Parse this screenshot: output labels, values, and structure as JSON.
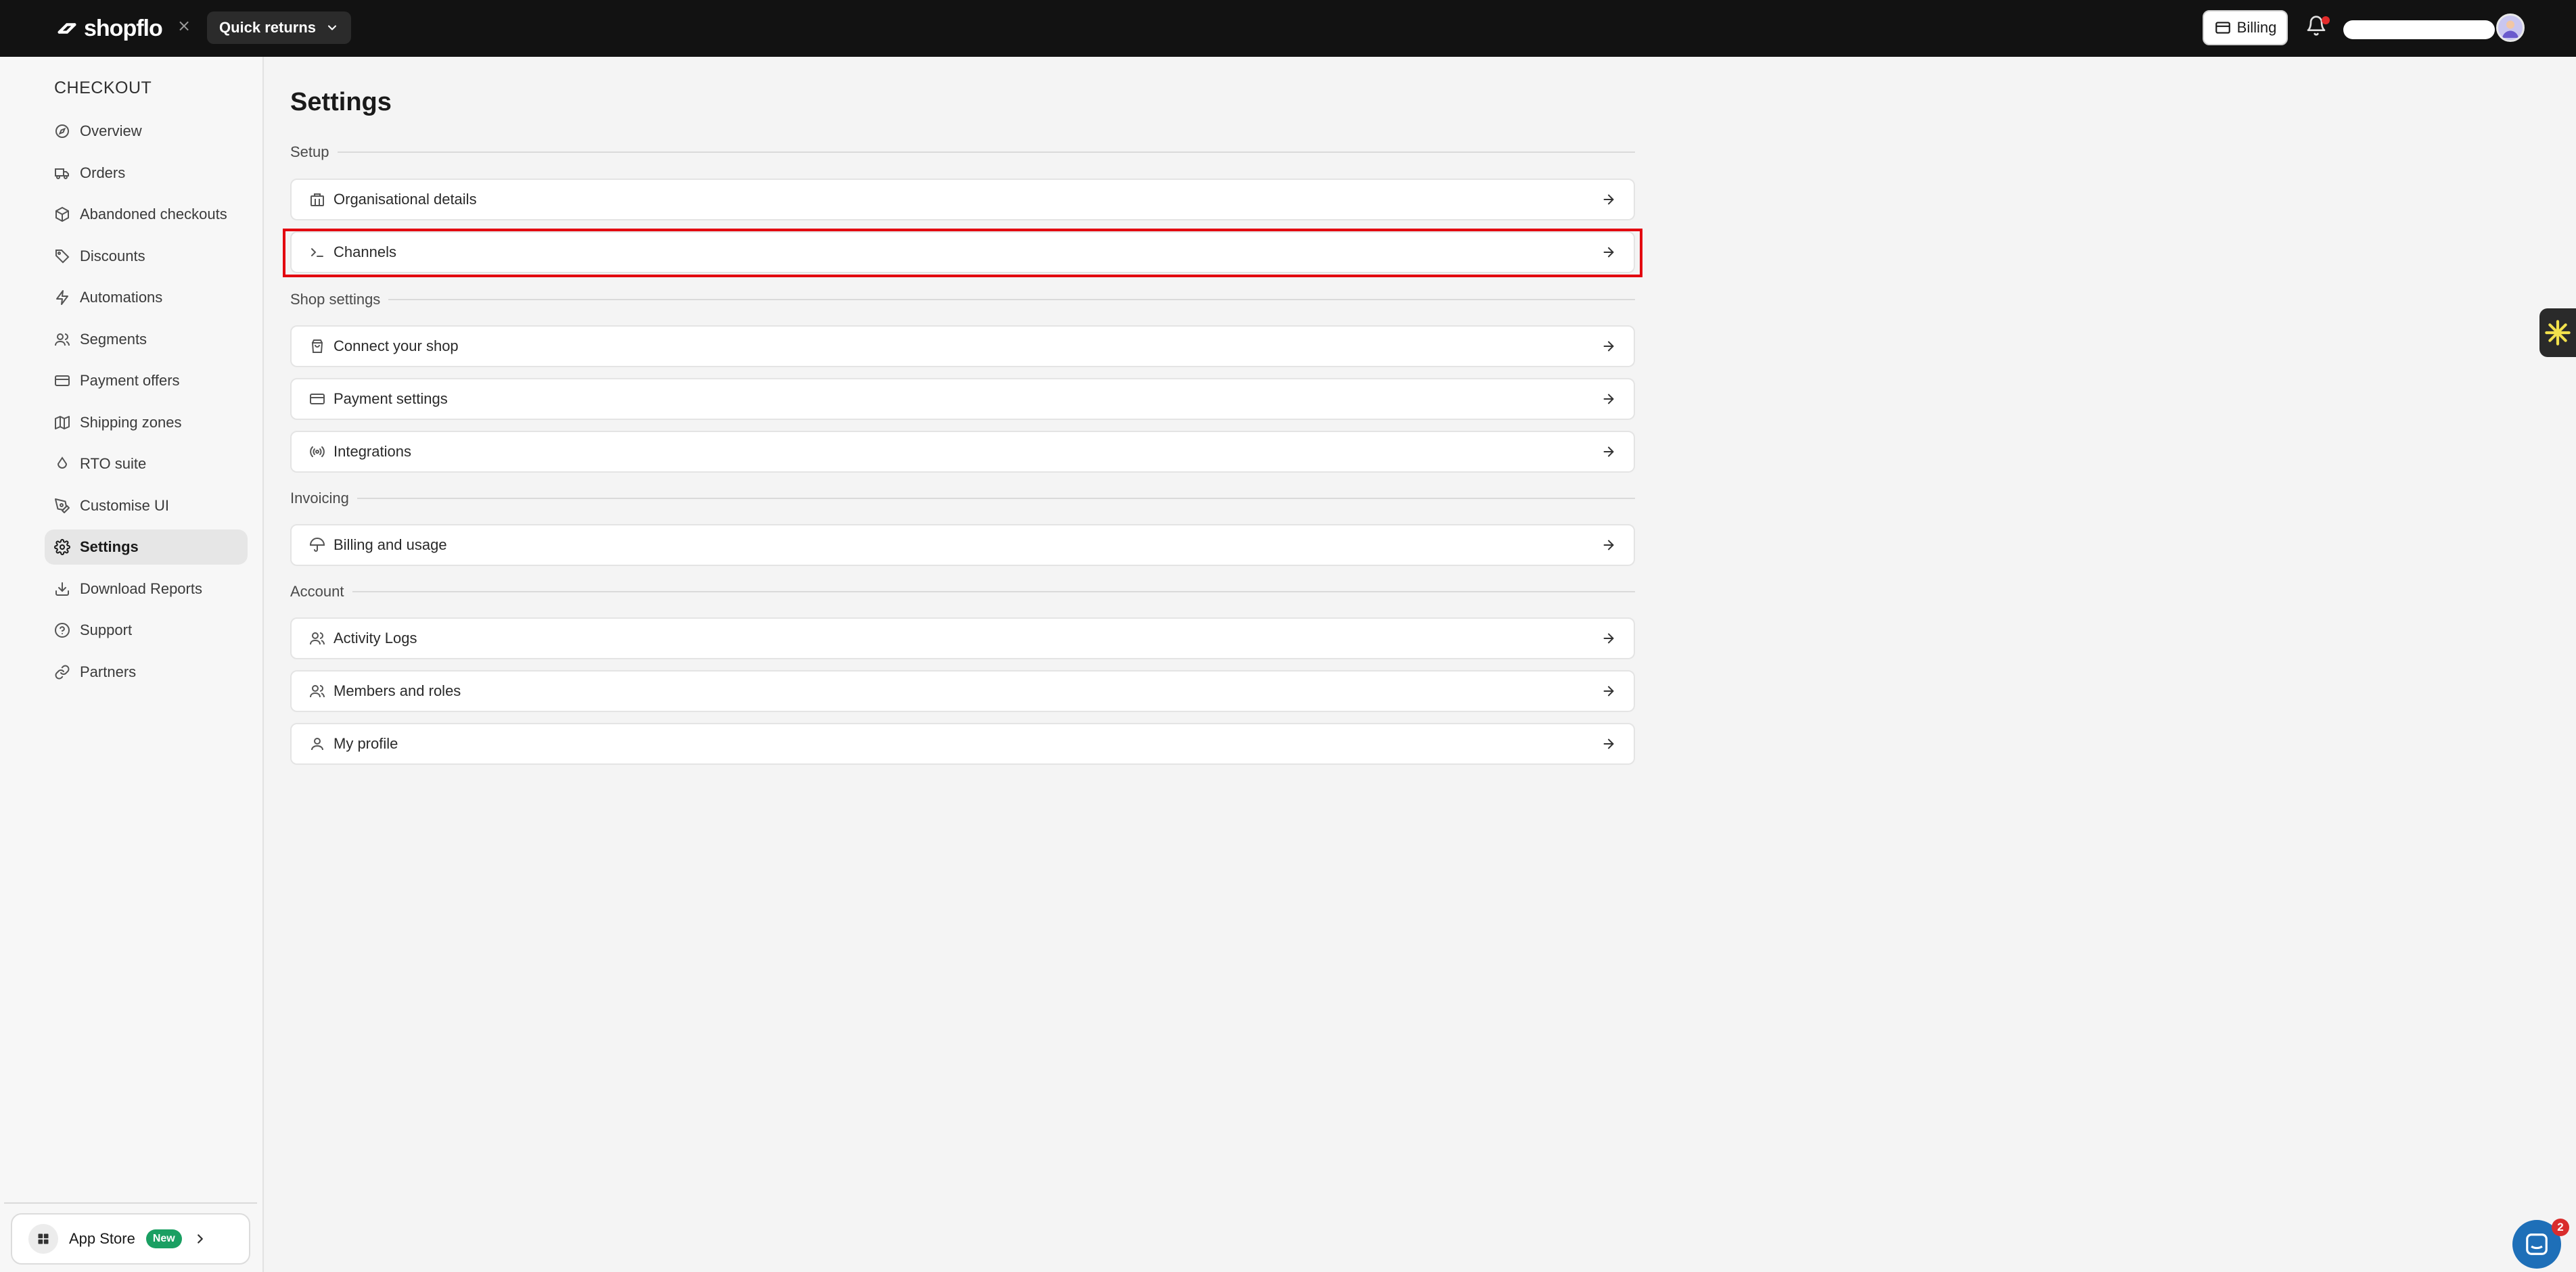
{
  "topbar": {
    "brand": "shopflo",
    "close_glyph": "×",
    "store_name": "Quick returns",
    "billing_label": "Billing",
    "icons": {
      "logo": "shopflo-logo-icon",
      "store_chevron": "chevron-down-icon",
      "billing": "credit-card-icon",
      "notifications": "bell-icon",
      "avatar": "avatar"
    }
  },
  "sidebar": {
    "heading": "CHECKOUT",
    "items": [
      {
        "label": "Overview",
        "icon": "compass-icon"
      },
      {
        "label": "Orders",
        "icon": "truck-icon"
      },
      {
        "label": "Abandoned checkouts",
        "icon": "box-icon"
      },
      {
        "label": "Discounts",
        "icon": "tag-icon"
      },
      {
        "label": "Automations",
        "icon": "bolt-icon"
      },
      {
        "label": "Segments",
        "icon": "users-icon"
      },
      {
        "label": "Payment offers",
        "icon": "credit-card-icon"
      },
      {
        "label": "Shipping zones",
        "icon": "map-icon"
      },
      {
        "label": "RTO suite",
        "icon": "droplet-icon"
      },
      {
        "label": "Customise UI",
        "icon": "pen-icon"
      },
      {
        "label": "Settings",
        "icon": "gear-icon",
        "active": true
      },
      {
        "label": "Download Reports",
        "icon": "download-icon"
      },
      {
        "label": "Support",
        "icon": "help-circle-icon"
      },
      {
        "label": "Partners",
        "icon": "link-icon"
      }
    ],
    "app_store": {
      "label": "App Store",
      "badge": "New"
    }
  },
  "main": {
    "title": "Settings",
    "sections": {
      "setup": {
        "label": "Setup",
        "items": [
          {
            "label": "Organisational details",
            "icon": "building-icon"
          },
          {
            "label": "Channels",
            "icon": "terminal-icon"
          }
        ]
      },
      "shop": {
        "label": "Shop settings",
        "items": [
          {
            "label": "Connect your shop",
            "icon": "shopping-bag-icon"
          },
          {
            "label": "Payment settings",
            "icon": "credit-card-icon"
          },
          {
            "label": "Integrations",
            "icon": "radio-icon"
          }
        ]
      },
      "invoicing": {
        "label": "Invoicing",
        "items": [
          {
            "label": "Billing and usage",
            "icon": "umbrella-icon"
          }
        ]
      },
      "account": {
        "label": "Account",
        "items": [
          {
            "label": "Activity Logs",
            "icon": "users-icon"
          },
          {
            "label": "Members and roles",
            "icon": "users-icon"
          },
          {
            "label": "My profile",
            "icon": "user-icon"
          }
        ]
      }
    }
  },
  "floating": {
    "chat_unread": "2"
  },
  "colors": {
    "topbar": "#121212",
    "highlight": "#e3000f",
    "badge_new": "#1a9f62",
    "chat": "#1e6fb8"
  }
}
